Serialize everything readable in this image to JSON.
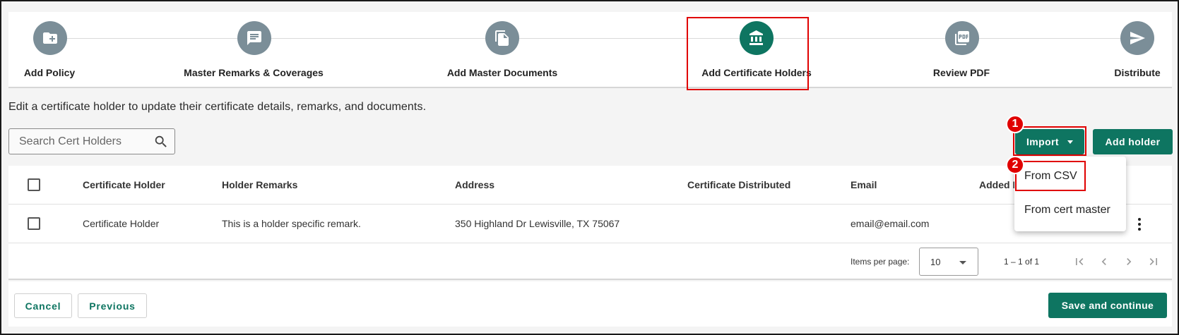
{
  "stepper": {
    "steps": [
      {
        "label": "Add Policy",
        "icon": "folder-plus-icon",
        "state": "default"
      },
      {
        "label": "Master Remarks & Coverages",
        "icon": "comment-icon",
        "state": "default"
      },
      {
        "label": "Add Master Documents",
        "icon": "documents-icon",
        "state": "default"
      },
      {
        "label": "Add Certificate Holders",
        "icon": "bank-icon",
        "state": "active"
      },
      {
        "label": "Review PDF",
        "icon": "pdf-icon",
        "state": "default"
      },
      {
        "label": "Distribute",
        "icon": "send-icon",
        "state": "default"
      }
    ]
  },
  "helper_text": "Edit a certificate holder to update their certificate details, remarks, and documents.",
  "search": {
    "placeholder": "Search Cert Holders",
    "value": ""
  },
  "toolbar": {
    "import_label": "Import",
    "add_holder_label": "Add holder"
  },
  "import_menu": {
    "items": [
      "From CSV",
      "From cert master"
    ]
  },
  "badges": [
    "1",
    "2"
  ],
  "table": {
    "columns": [
      "Certificate Holder",
      "Holder Remarks",
      "Address",
      "Certificate Distributed",
      "Email",
      "Added F"
    ],
    "rows": [
      {
        "holder": "Certificate Holder",
        "remarks": "This is a holder specific remark.",
        "address": "350 Highland Dr Lewisville, TX 75067",
        "distributed": "",
        "email": "email@email.com",
        "added": ""
      }
    ]
  },
  "paginator": {
    "items_per_page_label": "Items per page:",
    "items_per_page": "10",
    "range": "1 – 1 of 1"
  },
  "footer": {
    "cancel_label": "Cancel",
    "previous_label": "Previous",
    "save_label": "Save and continue"
  },
  "colors": {
    "primary": "#0e7561",
    "step_inactive": "#7b8e98",
    "highlight": "#e00000"
  }
}
